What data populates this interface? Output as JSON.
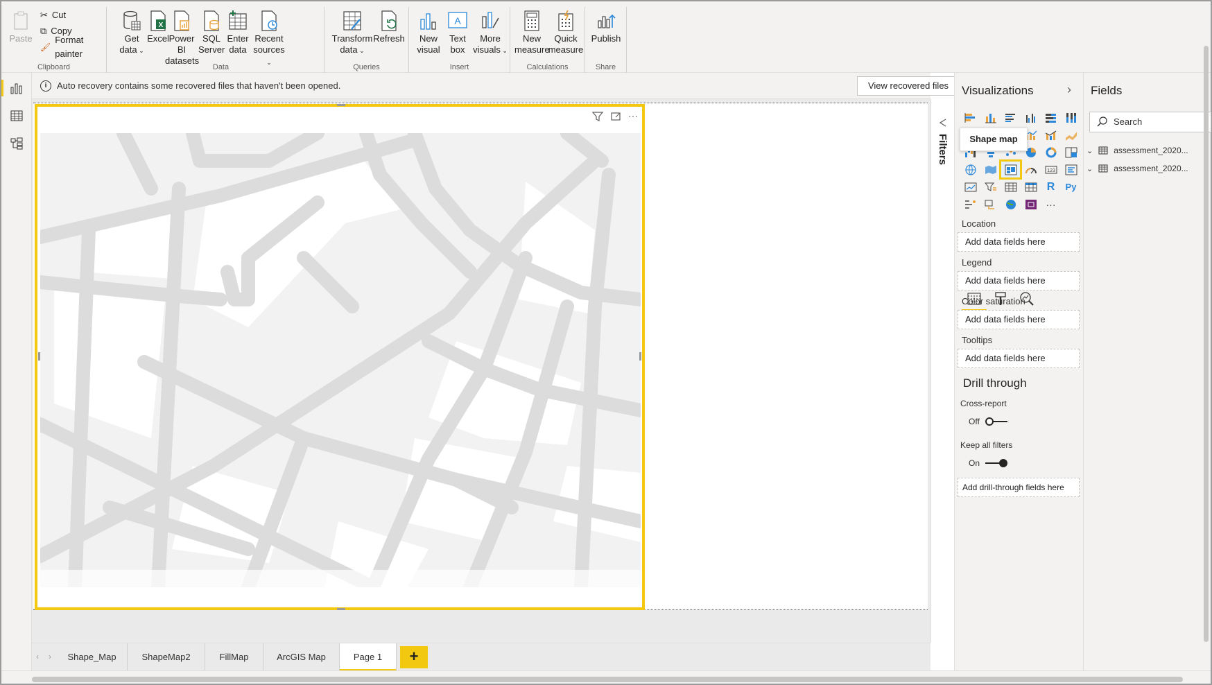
{
  "ribbon": {
    "clipboard": {
      "paste": "Paste",
      "cut": "Cut",
      "copy": "Copy",
      "format_painter": "Format painter",
      "label": "Clipboard"
    },
    "data": {
      "get_data": "Get",
      "get_data2": "data",
      "excel": "Excel",
      "pbi": "Power BI",
      "pbi2": "datasets",
      "sql": "SQL",
      "sql2": "Server",
      "enter": "Enter",
      "enter2": "data",
      "recent": "Recent",
      "recent2": "sources",
      "label": "Data"
    },
    "queries": {
      "transform": "Transform",
      "transform2": "data",
      "refresh": "Refresh",
      "label": "Queries"
    },
    "insert": {
      "new_visual": "New",
      "new_visual2": "visual",
      "text_box": "Text",
      "text_box2": "box",
      "more": "More",
      "more2": "visuals",
      "label": "Insert"
    },
    "calculations": {
      "new_measure": "New",
      "new_measure2": "measure",
      "quick": "Quick",
      "quick2": "measure",
      "label": "Calculations"
    },
    "share": {
      "publish": "Publish",
      "label": "Share"
    }
  },
  "infobar": {
    "message": "Auto recovery contains some recovered files that haven't been opened.",
    "button": "View recovered files",
    "close": "✕"
  },
  "filters": {
    "label": "Filters"
  },
  "tabs": [
    "Shape_Map",
    "ShapeMap2",
    "FillMap",
    "ArcGIS Map",
    "Page 1"
  ],
  "active_tab": "Page 1",
  "tab_add": "+",
  "visualizations": {
    "title": "Visualizations",
    "tooltip": "Shape map",
    "r_label": "R",
    "py_label": "Py",
    "more": "···",
    "wells": [
      {
        "label": "Location",
        "placeholder": "Add data fields here"
      },
      {
        "label": "Legend",
        "placeholder": "Add data fields here"
      },
      {
        "label": "Color saturation",
        "placeholder": "Add data fields here"
      },
      {
        "label": "Tooltips",
        "placeholder": "Add data fields here"
      }
    ],
    "drill_title": "Drill through",
    "cross_report": "Cross-report",
    "cross_report_state": "Off",
    "keep_filters": "Keep all filters",
    "keep_filters_state": "On",
    "drill_well": "Add drill-through fields here"
  },
  "fields": {
    "title": "Fields",
    "search_placeholder": "Search",
    "tables": [
      "assessment_2020...",
      "assessment_2020..."
    ]
  },
  "colors": {
    "accent": "#f2c811",
    "pane_bg": "#f3f2f1"
  }
}
